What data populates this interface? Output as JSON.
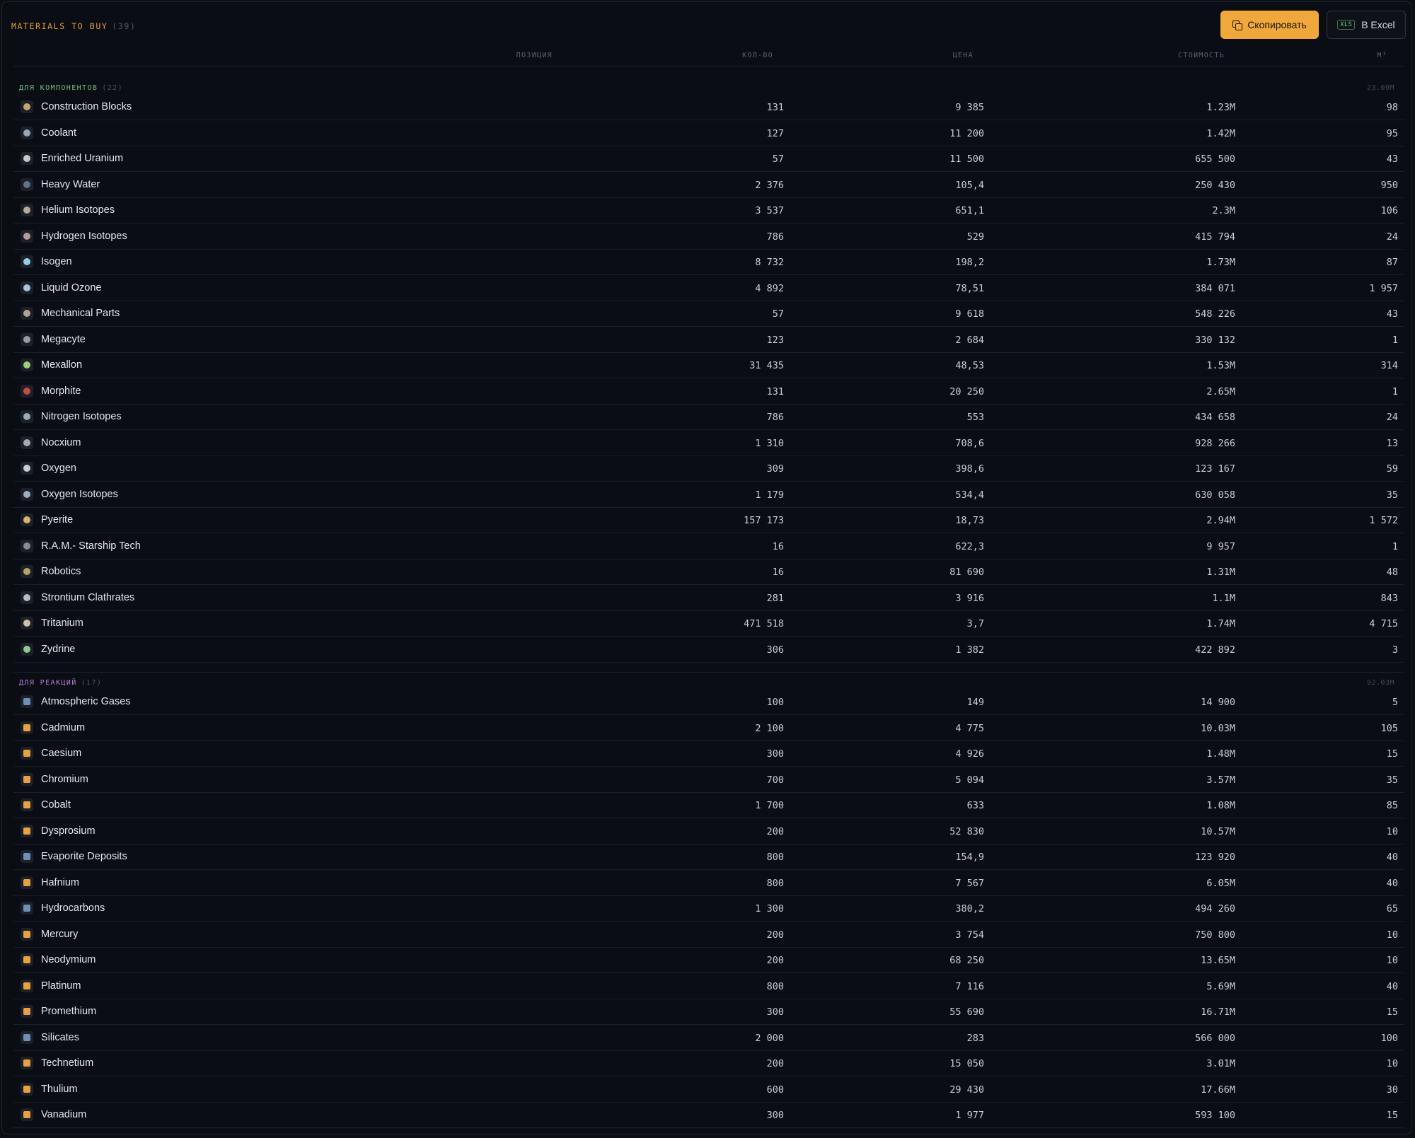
{
  "header": {
    "title": "MATERIALS TO BUY",
    "count": "(39)",
    "copy_button": "Скопировать",
    "excel_badge": "XLS",
    "excel_button": "В Excel"
  },
  "columns": {
    "position": "ПОЗИЦИЯ",
    "qty": "КОЛ-ВО",
    "price": "ЦЕНА",
    "cost": "СТОИМОСТЬ",
    "volume": "М³"
  },
  "colors": {
    "accent": "#f0a83a",
    "components_section": "#6ec07a",
    "reactions_section": "#b77ad6"
  },
  "sections": [
    {
      "name": "ДЛЯ КОМПОНЕНТОВ",
      "count": "(22)",
      "total": "23.09M",
      "rows": [
        {
          "name": "Construction Blocks",
          "qty": "131",
          "price": "9 385",
          "cost": "1.23M",
          "m3": "98",
          "icon": "construction-blocks-icon",
          "color": "#c9a46a"
        },
        {
          "name": "Coolant",
          "qty": "127",
          "price": "11 200",
          "cost": "1.42M",
          "m3": "95",
          "icon": "coolant-icon",
          "color": "#9aa6b4"
        },
        {
          "name": "Enriched Uranium",
          "qty": "57",
          "price": "11 500",
          "cost": "655 500",
          "m3": "43",
          "icon": "enriched-uranium-icon",
          "color": "#c8c8c8"
        },
        {
          "name": "Heavy Water",
          "qty": "2 376",
          "price": "105,4",
          "cost": "250 430",
          "m3": "950",
          "icon": "heavy-water-icon",
          "color": "#5f7388"
        },
        {
          "name": "Helium Isotopes",
          "qty": "3 537",
          "price": "651,1",
          "cost": "2.3M",
          "m3": "106",
          "icon": "helium-isotopes-icon",
          "color": "#b8a89a"
        },
        {
          "name": "Hydrogen Isotopes",
          "qty": "786",
          "price": "529",
          "cost": "415 794",
          "m3": "24",
          "icon": "hydrogen-isotopes-icon",
          "color": "#b89a9a"
        },
        {
          "name": "Isogen",
          "qty": "8 732",
          "price": "198,2",
          "cost": "1.73M",
          "m3": "87",
          "icon": "isogen-icon",
          "color": "#8fd0e8"
        },
        {
          "name": "Liquid Ozone",
          "qty": "4 892",
          "price": "78,51",
          "cost": "384 071",
          "m3": "1 957",
          "icon": "liquid-ozone-icon",
          "color": "#a8c4dc"
        },
        {
          "name": "Mechanical Parts",
          "qty": "57",
          "price": "9 618",
          "cost": "548 226",
          "m3": "43",
          "icon": "mechanical-parts-icon",
          "color": "#b0a690"
        },
        {
          "name": "Megacyte",
          "qty": "123",
          "price": "2 684",
          "cost": "330 132",
          "m3": "1",
          "icon": "megacyte-icon",
          "color": "#9a9aa6"
        },
        {
          "name": "Mexallon",
          "qty": "31 435",
          "price": "48,53",
          "cost": "1.53M",
          "m3": "314",
          "icon": "mexallon-icon",
          "color": "#9ccf78"
        },
        {
          "name": "Morphite",
          "qty": "131",
          "price": "20 250",
          "cost": "2.65M",
          "m3": "1",
          "icon": "morphite-icon",
          "color": "#c84a3e"
        },
        {
          "name": "Nitrogen Isotopes",
          "qty": "786",
          "price": "553",
          "cost": "434 658",
          "m3": "24",
          "icon": "nitrogen-isotopes-icon",
          "color": "#9aa8b8"
        },
        {
          "name": "Nocxium",
          "qty": "1 310",
          "price": "708,6",
          "cost": "928 266",
          "m3": "13",
          "icon": "nocxium-icon",
          "color": "#a8a8b4"
        },
        {
          "name": "Oxygen",
          "qty": "309",
          "price": "398,6",
          "cost": "123 167",
          "m3": "59",
          "icon": "oxygen-icon",
          "color": "#c4ccd4"
        },
        {
          "name": "Oxygen Isotopes",
          "qty": "1 179",
          "price": "534,4",
          "cost": "630 058",
          "m3": "35",
          "icon": "oxygen-isotopes-icon",
          "color": "#9ab0c0"
        },
        {
          "name": "Pyerite",
          "qty": "157 173",
          "price": "18,73",
          "cost": "2.94M",
          "m3": "1 572",
          "icon": "pyerite-icon",
          "color": "#d8b46a"
        },
        {
          "name": "R.A.M.- Starship Tech",
          "qty": "16",
          "price": "622,3",
          "cost": "9 957",
          "m3": "1",
          "icon": "ram-starship-tech-icon",
          "color": "#8a8a96"
        },
        {
          "name": "Robotics",
          "qty": "16",
          "price": "81 690",
          "cost": "1.31M",
          "m3": "48",
          "icon": "robotics-icon",
          "color": "#b8a46a"
        },
        {
          "name": "Strontium Clathrates",
          "qty": "281",
          "price": "3 916",
          "cost": "1.1M",
          "m3": "843",
          "icon": "strontium-clathrates-icon",
          "color": "#b4bcc4"
        },
        {
          "name": "Tritanium",
          "qty": "471 518",
          "price": "3,7",
          "cost": "1.74M",
          "m3": "4 715",
          "icon": "tritanium-icon",
          "color": "#d0c0a8"
        },
        {
          "name": "Zydrine",
          "qty": "306",
          "price": "1 382",
          "cost": "422 892",
          "m3": "3",
          "icon": "zydrine-icon",
          "color": "#8ec890"
        }
      ]
    },
    {
      "name": "ДЛЯ РЕАКЦИЙ",
      "count": "(17)",
      "total": "92.03M",
      "rows": [
        {
          "name": "Atmospheric Gases",
          "qty": "100",
          "price": "149",
          "cost": "14 900",
          "m3": "5",
          "icon": "atmospheric-gases-icon",
          "color": "#6f8fb8"
        },
        {
          "name": "Cadmium",
          "qty": "2 100",
          "price": "4 775",
          "cost": "10.03M",
          "m3": "105",
          "icon": "cadmium-icon",
          "color": "#e8a23c"
        },
        {
          "name": "Caesium",
          "qty": "300",
          "price": "4 926",
          "cost": "1.48M",
          "m3": "15",
          "icon": "caesium-icon",
          "color": "#e8a23c"
        },
        {
          "name": "Chromium",
          "qty": "700",
          "price": "5 094",
          "cost": "3.57M",
          "m3": "35",
          "icon": "chromium-icon",
          "color": "#e8a23c"
        },
        {
          "name": "Cobalt",
          "qty": "1 700",
          "price": "633",
          "cost": "1.08M",
          "m3": "85",
          "icon": "cobalt-icon",
          "color": "#e8a23c"
        },
        {
          "name": "Dysprosium",
          "qty": "200",
          "price": "52 830",
          "cost": "10.57M",
          "m3": "10",
          "icon": "dysprosium-icon",
          "color": "#e8a23c"
        },
        {
          "name": "Evaporite Deposits",
          "qty": "800",
          "price": "154,9",
          "cost": "123 920",
          "m3": "40",
          "icon": "evaporite-deposits-icon",
          "color": "#6f8fb8"
        },
        {
          "name": "Hafnium",
          "qty": "800",
          "price": "7 567",
          "cost": "6.05M",
          "m3": "40",
          "icon": "hafnium-icon",
          "color": "#e8a23c"
        },
        {
          "name": "Hydrocarbons",
          "qty": "1 300",
          "price": "380,2",
          "cost": "494 260",
          "m3": "65",
          "icon": "hydrocarbons-icon",
          "color": "#6f8fb8"
        },
        {
          "name": "Mercury",
          "qty": "200",
          "price": "3 754",
          "cost": "750 800",
          "m3": "10",
          "icon": "mercury-icon",
          "color": "#e8a23c"
        },
        {
          "name": "Neodymium",
          "qty": "200",
          "price": "68 250",
          "cost": "13.65M",
          "m3": "10",
          "icon": "neodymium-icon",
          "color": "#e8a23c"
        },
        {
          "name": "Platinum",
          "qty": "800",
          "price": "7 116",
          "cost": "5.69M",
          "m3": "40",
          "icon": "platinum-icon",
          "color": "#e8a23c"
        },
        {
          "name": "Promethium",
          "qty": "300",
          "price": "55 690",
          "cost": "16.71M",
          "m3": "15",
          "icon": "promethium-icon",
          "color": "#e8a23c"
        },
        {
          "name": "Silicates",
          "qty": "2 000",
          "price": "283",
          "cost": "566 000",
          "m3": "100",
          "icon": "silicates-icon",
          "color": "#6f8fb8"
        },
        {
          "name": "Technetium",
          "qty": "200",
          "price": "15 050",
          "cost": "3.01M",
          "m3": "10",
          "icon": "technetium-icon",
          "color": "#e8a23c"
        },
        {
          "name": "Thulium",
          "qty": "600",
          "price": "29 430",
          "cost": "17.66M",
          "m3": "30",
          "icon": "thulium-icon",
          "color": "#e8a23c"
        },
        {
          "name": "Vanadium",
          "qty": "300",
          "price": "1 977",
          "cost": "593 100",
          "m3": "15",
          "icon": "vanadium-icon",
          "color": "#e8a23c"
        }
      ]
    }
  ]
}
